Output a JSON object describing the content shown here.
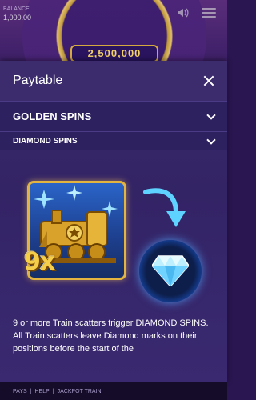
{
  "background": {
    "balance_label": "BALANCE",
    "balance_value": "1,000.00",
    "jackpot_value": "2,500,000"
  },
  "modal": {
    "title": "Paytable",
    "sections": [
      {
        "title": "GOLDEN SPINS"
      },
      {
        "title": "DIAMOND SPINS"
      }
    ],
    "symbol_multiplier": "9x",
    "description": "9 or more Train scatters trigger DIAMOND SPINS. All Train scatters leave Diamond marks on their positions before the start of the"
  },
  "footer": {
    "pays": "PAYS",
    "help": "HELP",
    "game_name": "JACKPOT TRAIN"
  },
  "colors": {
    "accent_gold": "#f6cf4a",
    "modal_bg": "#3a2a6a",
    "diamond_blue": "#5fd3ff"
  },
  "icons": [
    "sound-icon",
    "menu-icon",
    "close-icon",
    "chevron-down-icon",
    "train-scatter-icon",
    "arrow-icon",
    "diamond-icon"
  ]
}
